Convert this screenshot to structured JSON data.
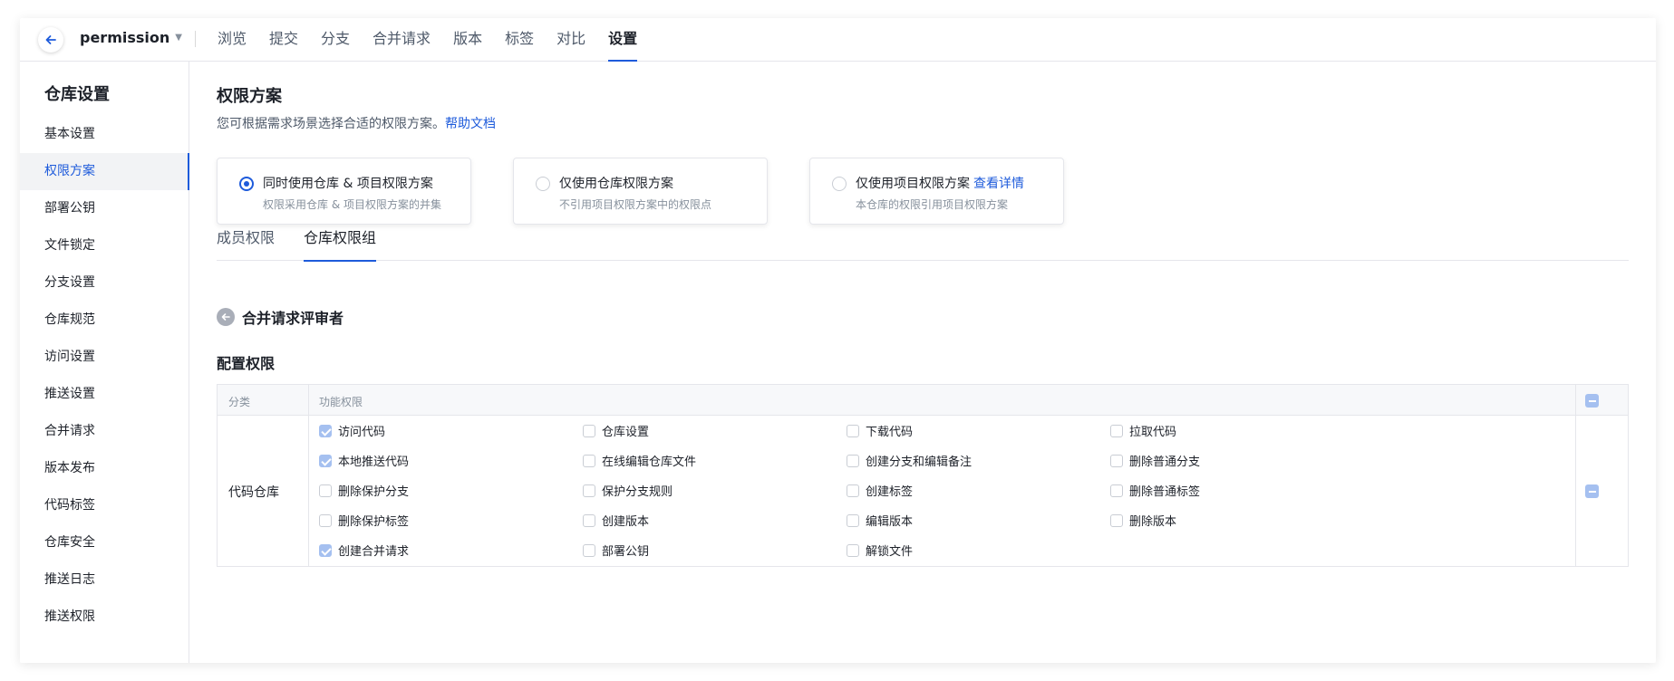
{
  "header": {
    "repo_name": "permission",
    "nav": [
      "浏览",
      "提交",
      "分支",
      "合并请求",
      "版本",
      "标签",
      "对比",
      "设置"
    ],
    "active_nav": "设置"
  },
  "sidebar": {
    "title": "仓库设置",
    "items": [
      {
        "label": "基本设置"
      },
      {
        "label": "权限方案",
        "active": true
      },
      {
        "label": "部署公钥"
      },
      {
        "label": "文件锁定"
      },
      {
        "label": "分支设置"
      },
      {
        "label": "仓库规范"
      },
      {
        "label": "访问设置"
      },
      {
        "label": "推送设置"
      },
      {
        "label": "合并请求"
      },
      {
        "label": "版本发布"
      },
      {
        "label": "代码标签"
      },
      {
        "label": "仓库安全"
      },
      {
        "label": "推送日志"
      },
      {
        "label": "推送权限"
      }
    ]
  },
  "main": {
    "title": "权限方案",
    "desc": "您可根据需求场景选择合适的权限方案。",
    "help_link": "帮助文档",
    "schemes": [
      {
        "title": "同时使用仓库 & 项目权限方案",
        "link": "",
        "sub": "权限采用仓库 & 项目权限方案的并集",
        "selected": true
      },
      {
        "title": "仅使用仓库权限方案",
        "link": "",
        "sub": "不引用项目权限方案中的权限点",
        "selected": false
      },
      {
        "title": "仅使用项目权限方案",
        "link": "查看详情",
        "sub": "本仓库的权限引用项目权限方案",
        "selected": false
      }
    ],
    "tabs": [
      {
        "label": "成员权限",
        "active": false
      },
      {
        "label": "仓库权限组",
        "active": true
      }
    ],
    "group_name": "合并请求评审者",
    "config_title": "配置权限",
    "table": {
      "col_category": "分类",
      "col_function": "功能权限",
      "category": "代码仓库",
      "permissions": [
        {
          "label": "访问代码",
          "checked": true
        },
        {
          "label": "仓库设置",
          "checked": false
        },
        {
          "label": "下载代码",
          "checked": false
        },
        {
          "label": "拉取代码",
          "checked": false
        },
        {
          "label": "本地推送代码",
          "checked": true
        },
        {
          "label": "在线编辑仓库文件",
          "checked": false
        },
        {
          "label": "创建分支和编辑备注",
          "checked": false
        },
        {
          "label": "删除普通分支",
          "checked": false
        },
        {
          "label": "删除保护分支",
          "checked": false
        },
        {
          "label": "保护分支规则",
          "checked": false
        },
        {
          "label": "创建标签",
          "checked": false
        },
        {
          "label": "删除普通标签",
          "checked": false
        },
        {
          "label": "删除保护标签",
          "checked": false
        },
        {
          "label": "创建版本",
          "checked": false
        },
        {
          "label": "编辑版本",
          "checked": false
        },
        {
          "label": "删除版本",
          "checked": false
        },
        {
          "label": "创建合并请求",
          "checked": true
        },
        {
          "label": "部署公钥",
          "checked": false
        },
        {
          "label": "解锁文件",
          "checked": false
        }
      ]
    }
  },
  "colors": {
    "accent": "#1e5bdb",
    "checked_disabled": "#a5c0f0",
    "border": "#e5e6eb"
  }
}
